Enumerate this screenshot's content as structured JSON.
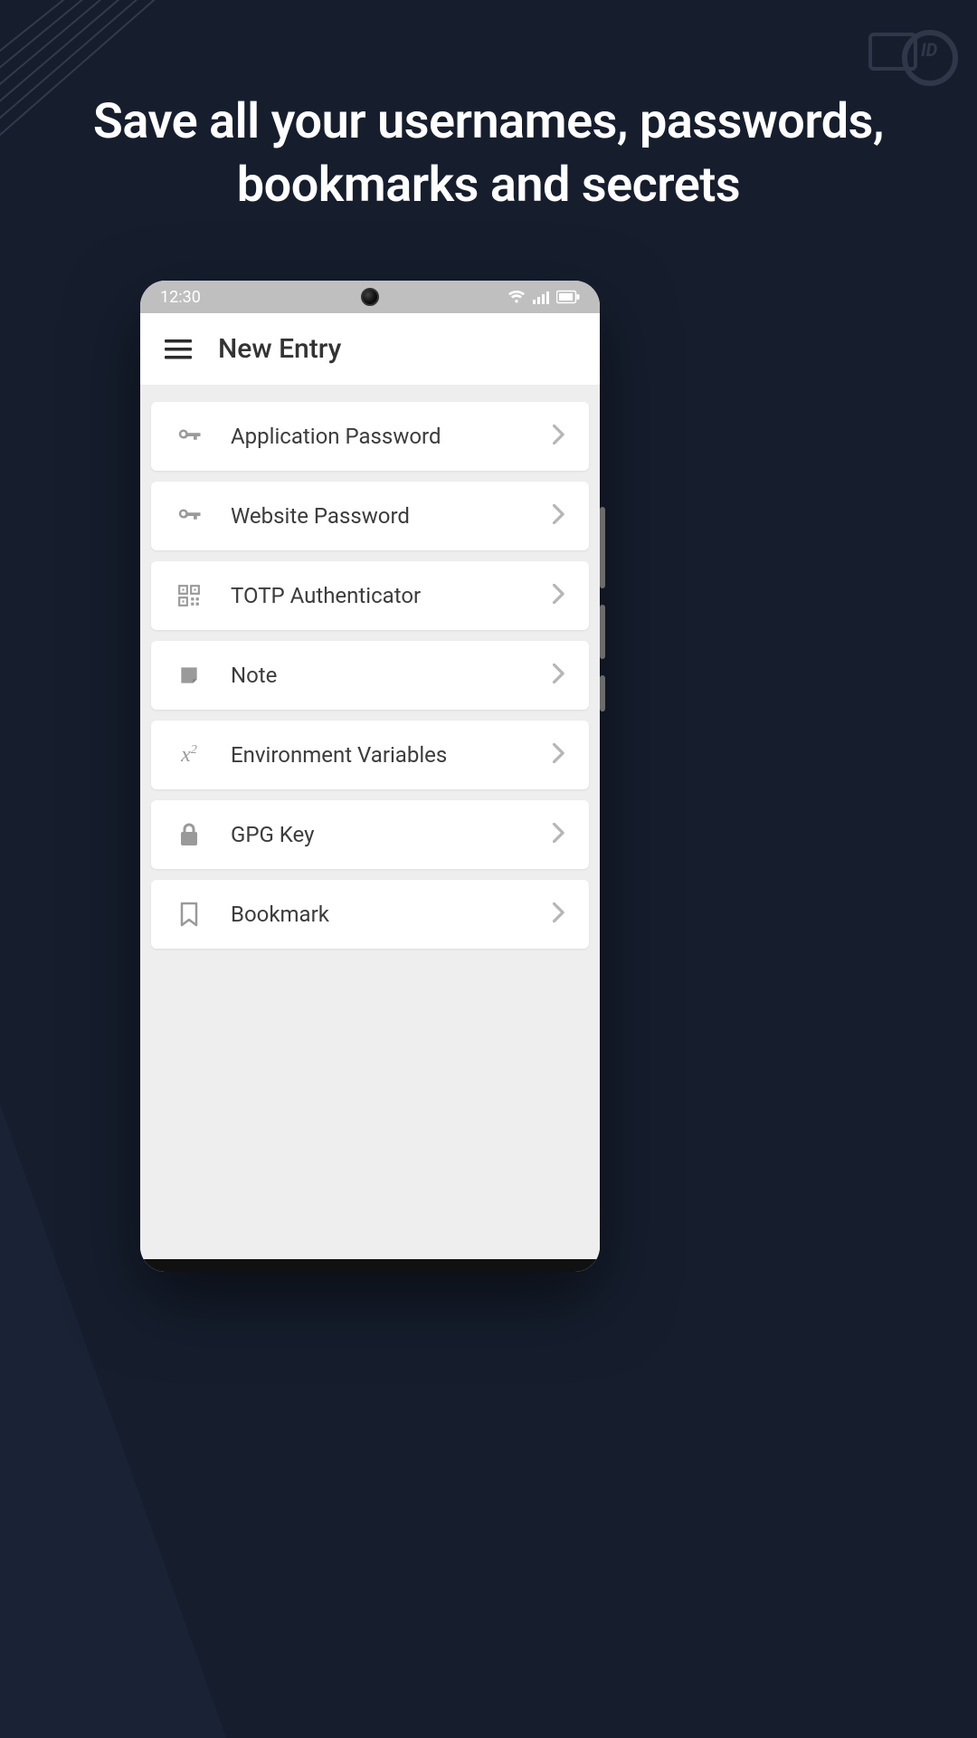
{
  "marketing": {
    "headline": "Save all your usernames, passwords, bookmarks and secrets"
  },
  "status_bar": {
    "time": "12:30"
  },
  "app": {
    "header_title": "New Entry"
  },
  "entries": [
    {
      "icon": "key",
      "label": "Application Password"
    },
    {
      "icon": "key",
      "label": "Website Password"
    },
    {
      "icon": "qr",
      "label": "TOTP Authenticator"
    },
    {
      "icon": "note",
      "label": "Note"
    },
    {
      "icon": "x2",
      "label": "Environment Variables"
    },
    {
      "icon": "lock",
      "label": "GPG Key"
    },
    {
      "icon": "bookmark",
      "label": "Bookmark"
    }
  ]
}
